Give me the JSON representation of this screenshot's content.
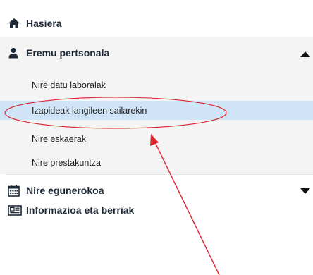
{
  "nav": {
    "home": {
      "label": "Hasiera",
      "icon": "home-icon"
    },
    "personal": {
      "label": "Eremu pertsonala",
      "icon": "user-icon",
      "expanded": true,
      "children": [
        {
          "label": "Nire datu laboralak"
        },
        {
          "label": "Izapideak langileen sailarekin",
          "highlighted": true
        },
        {
          "label": "Nire eskaerak"
        },
        {
          "label": "Nire prestakuntza"
        }
      ]
    },
    "daily": {
      "label": "Nire egunerokoa",
      "icon": "calendar-icon",
      "expanded": false
    },
    "news": {
      "label": "Informazioa eta berriak",
      "icon": "newspaper-icon"
    }
  },
  "colors": {
    "highlight_bg": "#cfe4f6",
    "annotation": "#d9242b",
    "panel_bg": "#f4f4f4",
    "text": "#1e2a38"
  }
}
